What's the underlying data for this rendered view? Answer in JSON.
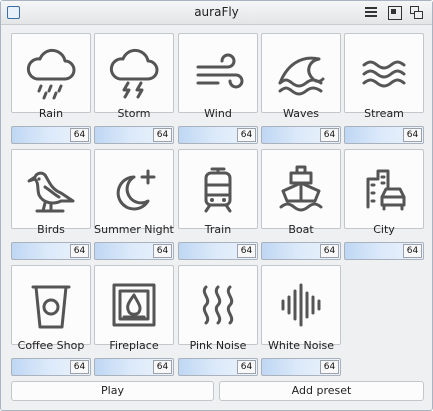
{
  "window": {
    "title": "auraFly"
  },
  "sounds": [
    {
      "label": "Rain",
      "icon": "rain-icon",
      "volume": "64"
    },
    {
      "label": "Storm",
      "icon": "storm-icon",
      "volume": "64"
    },
    {
      "label": "Wind",
      "icon": "wind-icon",
      "volume": "64"
    },
    {
      "label": "Waves",
      "icon": "waves-icon",
      "volume": "64"
    },
    {
      "label": "Stream",
      "icon": "stream-icon",
      "volume": "64"
    },
    {
      "label": "Birds",
      "icon": "bird-icon",
      "volume": "64"
    },
    {
      "label": "Summer Night",
      "icon": "moon-star-icon",
      "volume": "64"
    },
    {
      "label": "Train",
      "icon": "train-icon",
      "volume": "64"
    },
    {
      "label": "Boat",
      "icon": "boat-icon",
      "volume": "64"
    },
    {
      "label": "City",
      "icon": "city-icon",
      "volume": "64"
    },
    {
      "label": "Coffee Shop",
      "icon": "coffee-cup-icon",
      "volume": "64"
    },
    {
      "label": "Fireplace",
      "icon": "fireplace-icon",
      "volume": "64"
    },
    {
      "label": "Pink Noise",
      "icon": "pink-noise-icon",
      "volume": "64"
    },
    {
      "label": "White Noise",
      "icon": "white-noise-icon",
      "volume": "64"
    }
  ],
  "buttons": {
    "play": "Play",
    "add_preset": "Add preset"
  }
}
